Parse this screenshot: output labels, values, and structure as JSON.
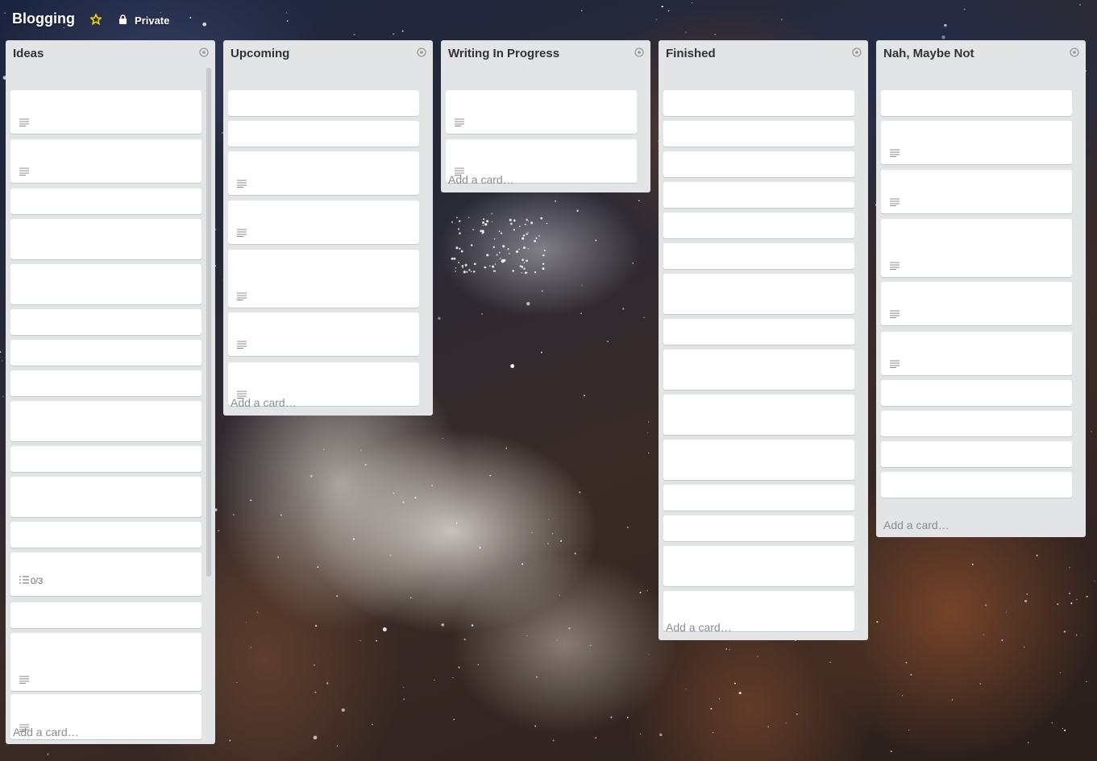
{
  "board": {
    "title": "Blogging",
    "privacy": "Private",
    "star_color": "#f2d600"
  },
  "add_card_label": "Add a card…",
  "lists": [
    {
      "name": "Ideas",
      "cards": [
        {
          "badge": "description"
        },
        {
          "badge": "description"
        },
        {},
        {},
        {},
        {},
        {},
        {},
        {},
        {},
        {},
        {},
        {
          "badge": "checklist",
          "checklist": "0/3"
        },
        {},
        {
          "badge": "description"
        },
        {
          "badge": "description"
        }
      ]
    },
    {
      "name": "Upcoming",
      "cards": [
        {},
        {},
        {
          "badge": "description"
        },
        {
          "badge": "description"
        },
        {
          "badge": "description"
        },
        {
          "badge": "description"
        },
        {
          "badge": "description"
        }
      ]
    },
    {
      "name": "Writing In Progress",
      "cards": [
        {
          "badge": "description"
        },
        {
          "badge": "description"
        }
      ]
    },
    {
      "name": "Finished",
      "cards": [
        {},
        {},
        {},
        {},
        {},
        {},
        {},
        {},
        {},
        {},
        {},
        {},
        {},
        {},
        {}
      ]
    },
    {
      "name": "Nah, Maybe Not",
      "cards": [
        {},
        {
          "badge": "description"
        },
        {
          "badge": "description"
        },
        {
          "badge": "description"
        },
        {
          "badge": "description"
        },
        {
          "badge": "description"
        },
        {},
        {},
        {},
        {}
      ]
    }
  ]
}
